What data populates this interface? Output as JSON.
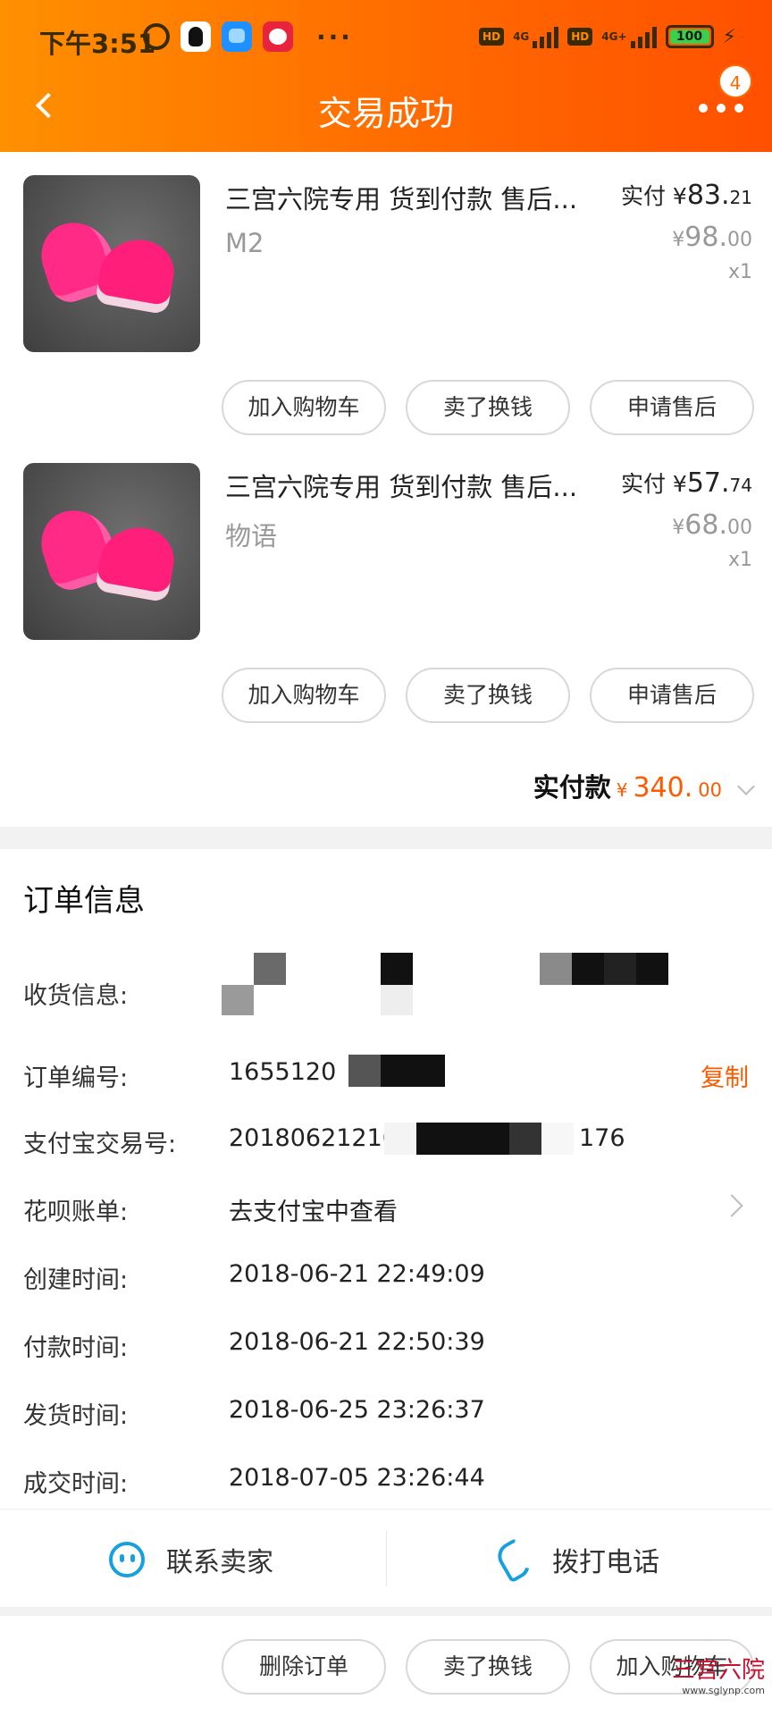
{
  "status_bar": {
    "time": "下午3:51",
    "network_1": "4G",
    "network_2": "4G+",
    "hd": "HD",
    "battery": "100",
    "more": "···"
  },
  "header": {
    "title": "交易成功",
    "badge_count": "4"
  },
  "items": [
    {
      "title": "三宫六院专用 货到付款 售后...",
      "spec": "M2",
      "paid_label": "实付",
      "paid_yen": "¥",
      "paid_int": "83.",
      "paid_dec": "21",
      "orig_yen": "¥",
      "orig_int": "98.",
      "orig_dec": "00",
      "qty": "x1",
      "buttons": [
        "加入购物车",
        "卖了换钱",
        "申请售后"
      ]
    },
    {
      "title": "三宫六院专用 货到付款 售后...",
      "spec": "物语",
      "paid_label": "实付",
      "paid_yen": "¥",
      "paid_int": "57.",
      "paid_dec": "74",
      "orig_yen": "¥",
      "orig_int": "68.",
      "orig_dec": "00",
      "qty": "x1",
      "buttons": [
        "加入购物车",
        "卖了换钱",
        "申请售后"
      ]
    }
  ],
  "total": {
    "label": "实付款",
    "yen": "¥",
    "int": "340.",
    "dec": "00"
  },
  "order_info": {
    "title": "订单信息",
    "shipping_label": "收货信息:",
    "order_no_label": "订单编号:",
    "order_no_value": "1655120",
    "copy_label": "复制",
    "alipay_label": "支付宝交易号:",
    "alipay_value_start": "20180621210",
    "alipay_value_end": "176",
    "huabei_label": "花呗账单:",
    "huabei_value": "去支付宝中查看",
    "created_label": "创建时间:",
    "created_value": "2018-06-21 22:49:09",
    "paid_label": "付款时间:",
    "paid_value": "2018-06-21 22:50:39",
    "shipped_label": "发货时间:",
    "shipped_value": "2018-06-25 23:26:37",
    "closed_label": "成交时间:",
    "closed_value": "2018-07-05 23:26:44"
  },
  "contact": {
    "seller_label": "联系卖家",
    "phone_label": "拨打电话"
  },
  "bottom_actions": [
    "删除订单",
    "卖了换钱",
    "加入购物车"
  ],
  "watermark": {
    "text": "三宫六院",
    "url": "www.sglynp.com"
  }
}
